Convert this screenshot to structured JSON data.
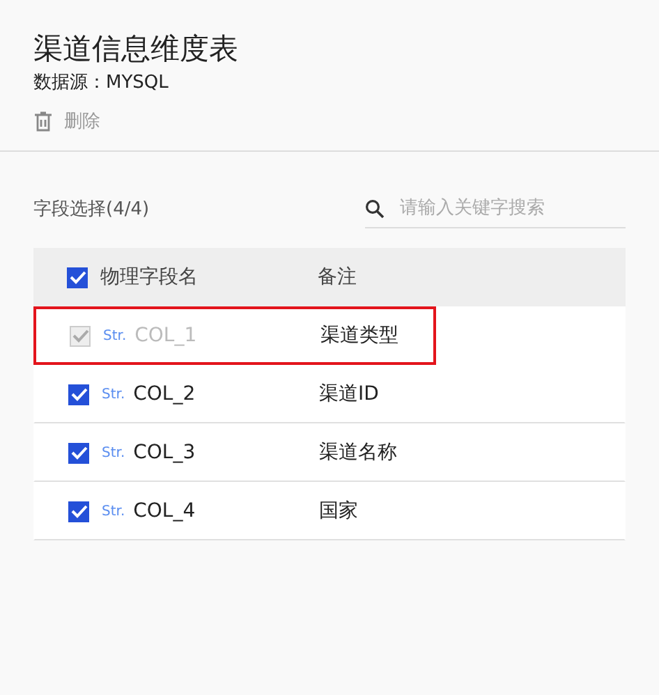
{
  "title": "渠道信息维度表",
  "source": "数据源：MYSQL",
  "delete_button": {
    "label": "删除"
  },
  "field_selection": {
    "label": "字段选择(4/4)"
  },
  "search": {
    "placeholder": "请输入关键字搜索"
  },
  "table": {
    "header_checked": true,
    "columns": [
      "物理字段名",
      "备注"
    ],
    "rows": [
      {
        "type": "Str.",
        "name": "COL_1",
        "note": "渠道类型",
        "checked": true,
        "disabled": true,
        "highlighted": true
      },
      {
        "type": "Str.",
        "name": "COL_2",
        "note": "渠道ID",
        "checked": true,
        "disabled": false,
        "highlighted": false
      },
      {
        "type": "Str.",
        "name": "COL_3",
        "note": "渠道名称",
        "checked": true,
        "disabled": false,
        "highlighted": false
      },
      {
        "type": "Str.",
        "name": "COL_4",
        "note": "国家",
        "checked": true,
        "disabled": false,
        "highlighted": false
      }
    ]
  }
}
